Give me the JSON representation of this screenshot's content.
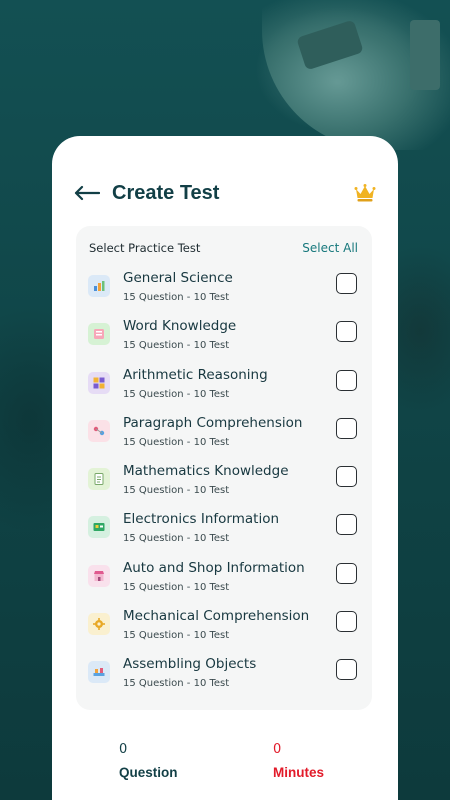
{
  "header": {
    "title": "Create Test",
    "back_icon": "arrow-left-icon",
    "premium_icon": "crown-icon",
    "accent_color": "#123f46",
    "crown_color": "#f0b323"
  },
  "panel": {
    "label": "Select Practice Test",
    "select_all": "Select All"
  },
  "tests": [
    {
      "name": "General Science",
      "sub": "15 Question - 10 Test",
      "icon": "science-icon",
      "icon_bg": "#dbe9f7",
      "checked": false
    },
    {
      "name": "Word Knowledge",
      "sub": "15 Question - 10 Test",
      "icon": "book-icon",
      "icon_bg": "#d6f2d4",
      "checked": false
    },
    {
      "name": "Arithmetic Reasoning",
      "sub": "15 Question - 10 Test",
      "icon": "calculator-icon",
      "icon_bg": "#e6dcf5",
      "checked": false
    },
    {
      "name": "Paragraph Comprehension",
      "sub": "15 Question - 10 Test",
      "icon": "paragraph-icon",
      "icon_bg": "#fbe1e7",
      "checked": false
    },
    {
      "name": "Mathematics Knowledge",
      "sub": "15 Question - 10 Test",
      "icon": "math-notebook-icon",
      "icon_bg": "#e3f3d6",
      "checked": false
    },
    {
      "name": "Electronics Information",
      "sub": "15 Question - 10 Test",
      "icon": "circuit-board-icon",
      "icon_bg": "#d5f0e0",
      "checked": false
    },
    {
      "name": "Auto and Shop Information",
      "sub": "15 Question - 10 Test",
      "icon": "shop-icon",
      "icon_bg": "#f9e1ec",
      "checked": false
    },
    {
      "name": "Mechanical Comprehension",
      "sub": "15 Question - 10 Test",
      "icon": "gear-icon",
      "icon_bg": "#faf0cf",
      "checked": false
    },
    {
      "name": "Assembling Objects",
      "sub": "15 Question - 10 Test",
      "icon": "assembly-icon",
      "icon_bg": "#dbe9f7",
      "checked": false
    }
  ],
  "stats": {
    "question_value": "0",
    "question_label": "Question",
    "minutes_value": "0",
    "minutes_label": "Minutes",
    "minutes_color": "#e21b2a"
  }
}
